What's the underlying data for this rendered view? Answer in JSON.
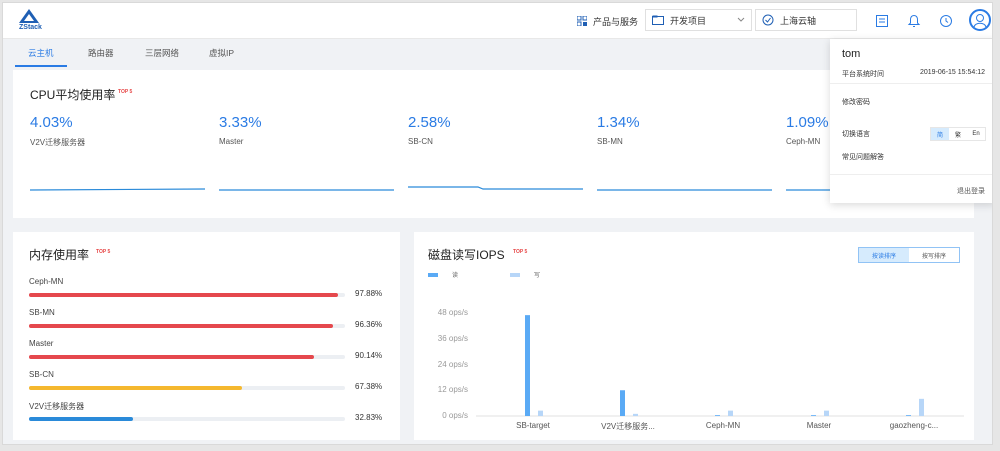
{
  "brand": "ZStack",
  "header": {
    "products": "产品与服务",
    "project": "开发项目",
    "region": "上海云轴"
  },
  "tabs": [
    "云主机",
    "路由器",
    "三层网络",
    "虚拟IP"
  ],
  "badge_top5": "TOP 5",
  "cpu": {
    "title": "CPU平均使用率",
    "items": [
      {
        "value": "4.03%",
        "name": "V2V迁移服务器"
      },
      {
        "value": "3.33%",
        "name": "Master"
      },
      {
        "value": "2.58%",
        "name": "SB-CN"
      },
      {
        "value": "1.34%",
        "name": "SB-MN"
      },
      {
        "value": "1.09%",
        "name": "Ceph-MN"
      }
    ]
  },
  "memory": {
    "title": "内存使用率",
    "items": [
      {
        "name": "Ceph-MN",
        "pct": "97.88%",
        "value": 97.88,
        "color": "#e5484d"
      },
      {
        "name": "SB-MN",
        "pct": "96.36%",
        "value": 96.36,
        "color": "#e5484d"
      },
      {
        "name": "Master",
        "pct": "90.14%",
        "value": 90.14,
        "color": "#e5484d"
      },
      {
        "name": "SB-CN",
        "pct": "67.38%",
        "value": 67.38,
        "color": "#f5b82e"
      },
      {
        "name": "V2V迁移服务器",
        "pct": "32.83%",
        "value": 32.83,
        "color": "#2a8ad9"
      }
    ]
  },
  "iops": {
    "title": "磁盘读写IOPS",
    "sort_read": "按读排序",
    "sort_write": "按写排序",
    "legend_read": "读",
    "legend_write": "写",
    "read_color": "#5aaaf5",
    "write_color": "#b7d6f8"
  },
  "chart_data": {
    "type": "bar",
    "title": "磁盘读写IOPS",
    "ylim": [
      0,
      48
    ],
    "yticks": [
      "0 ops/s",
      "12 ops/s",
      "24 ops/s",
      "36 ops/s",
      "48 ops/s"
    ],
    "categories": [
      "SB-target",
      "V2V迁移服务...",
      "Ceph-MN",
      "Master",
      "gaozheng-c..."
    ],
    "series": [
      {
        "name": "读",
        "values": [
          47,
          12,
          0,
          0,
          0
        ]
      },
      {
        "name": "写",
        "values": [
          2.5,
          1,
          2.5,
          2.5,
          8
        ]
      }
    ]
  },
  "popup": {
    "user": "tom",
    "time_label": "平台系统时间",
    "time": "2019-06-15 15:54:12",
    "change_pwd": "修改密码",
    "switch_lang": "切换语言",
    "lang_options": [
      "简",
      "繁",
      "En"
    ],
    "faq": "常见问题解答",
    "logout": "退出登录"
  }
}
